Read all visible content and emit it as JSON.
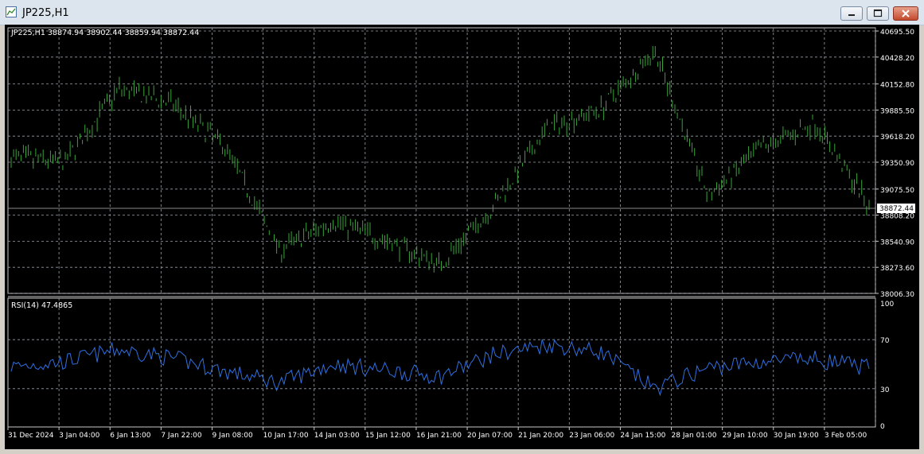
{
  "window": {
    "title": "JP225,H1",
    "icon": "chart-window-icon"
  },
  "controls": {
    "minimize": "minimize-icon",
    "maximize": "maximize-icon",
    "close": "close-icon"
  },
  "price_header": "JP225,H1  38874.94 38902.44 38859.94 38872.44",
  "current_price_label": "38872.44",
  "rsi_header": "RSI(14) 47.4865",
  "price_axis_labels": [
    "40695.50",
    "40428.20",
    "40152.80",
    "39885.50",
    "39618.20",
    "39350.90",
    "39075.50",
    "38808.20",
    "38540.90",
    "38273.60",
    "38006.30"
  ],
  "rsi_axis_labels": [
    "100",
    "70",
    "30",
    "0"
  ],
  "time_axis_labels": [
    "31 Dec 2024",
    "3 Jan 04:00",
    "6 Jan 13:00",
    "7 Jan 22:00",
    "9 Jan 08:00",
    "10 Jan 17:00",
    "14 Jan 03:00",
    "15 Jan 12:00",
    "16 Jan 21:00",
    "20 Jan 07:00",
    "21 Jan 20:00",
    "23 Jan 06:00",
    "24 Jan 15:00",
    "28 Jan 01:00",
    "29 Jan 10:00",
    "30 Jan 19:00",
    "3 Feb 05:00"
  ],
  "colors": {
    "background": "#000000",
    "bars": "#3aa33a",
    "rsi_line": "#2f6fe0",
    "grid": "#9aa0a6",
    "text": "#ffffff"
  },
  "chart_data": [
    {
      "type": "line",
      "title": "JP225,H1",
      "ylim": [
        38006.3,
        40695.5
      ],
      "x": [
        "31 Dec 2024",
        "3 Jan 04:00",
        "6 Jan 13:00",
        "7 Jan 22:00",
        "9 Jan 08:00",
        "10 Jan 17:00",
        "14 Jan 03:00",
        "15 Jan 12:00",
        "16 Jan 21:00",
        "20 Jan 07:00",
        "21 Jan 20:00",
        "23 Jan 06:00",
        "24 Jan 15:00",
        "28 Jan 01:00",
        "29 Jan 10:00",
        "30 Jan 19:00",
        "3 Feb 05:00"
      ],
      "series": [
        {
          "name": "",
          "values": [
            39400,
            39350,
            40100,
            39950,
            39500,
            38450,
            38750,
            38550,
            38300,
            38900,
            39700,
            39900,
            40500,
            39000,
            39500,
            39750,
            38900
          ]
        }
      ]
    },
    {
      "type": "line",
      "title": "RSI(14) 47.4865",
      "ylim": [
        0,
        100
      ],
      "x": [
        "31 Dec 2024",
        "3 Jan 04:00",
        "6 Jan 13:00",
        "7 Jan 22:00",
        "9 Jan 08:00",
        "10 Jan 17:00",
        "14 Jan 03:00",
        "15 Jan 12:00",
        "16 Jan 21:00",
        "20 Jan 07:00",
        "21 Jan 20:00",
        "23 Jan 06:00",
        "24 Jan 15:00",
        "28 Jan 01:00",
        "29 Jan 10:00",
        "30 Jan 19:00",
        "3 Feb 05:00"
      ],
      "series": [
        {
          "name": "",
          "values": [
            48,
            52,
            62,
            55,
            44,
            35,
            50,
            45,
            40,
            58,
            66,
            60,
            30,
            47,
            52,
            54,
            47
          ]
        }
      ]
    }
  ]
}
